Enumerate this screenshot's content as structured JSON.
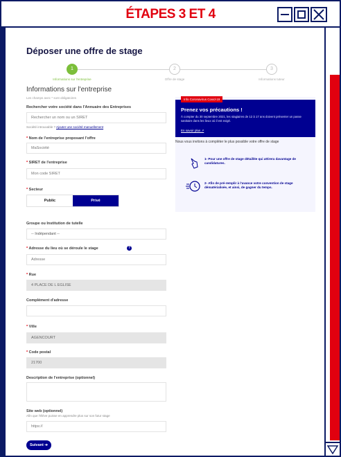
{
  "window": {
    "title": "ÉTAPES 3 ET 4"
  },
  "page": {
    "title": "Déposer une offre de stage"
  },
  "stepper": {
    "steps": [
      {
        "number": "1",
        "label": "Informations sur l'entreprise"
      },
      {
        "number": "2",
        "label": "Offre de stage"
      },
      {
        "number": "3",
        "label": "Informations tuteur"
      }
    ]
  },
  "section": {
    "title": "Informations sur l'entreprise",
    "required_note": "Les champs avec * sont obligatoires"
  },
  "form": {
    "search": {
      "label": "Rechercher votre société dans l'Annuaire des Entreprises",
      "placeholder": "Rechercher un nom ou un SIRET",
      "hint": "Société introuvable ?",
      "hint_link": "Ajouter une société manuellement"
    },
    "company_name": {
      "label": "Nom de l'entreprise proposant l'offre",
      "placeholder": "MaSociété"
    },
    "siret": {
      "label": "SIRET de l'entreprise",
      "placeholder": "Mon code SIRET"
    },
    "sector": {
      "label": "Secteur",
      "public": "Public",
      "prive": "Privé"
    },
    "group": {
      "label": "Groupe ou Institution de tutelle",
      "value": "-- Indépendant --"
    },
    "address": {
      "label": "Adresse du lieu où se déroule le stage",
      "placeholder": "Adresse"
    },
    "street": {
      "label": "Rue",
      "value": "4 PLACE DE L EGLISE"
    },
    "complement": {
      "label": "Complément d'adresse",
      "value": ""
    },
    "city": {
      "label": "Ville",
      "value": "AGENCOURT"
    },
    "postal": {
      "label": "Code postal",
      "value": "21700"
    },
    "description": {
      "label": "Description de l'entreprise (optionnel)",
      "value": ""
    },
    "website": {
      "label": "Site web (optionnel)",
      "hint": "Afin que l'élève puisse en apprendre plus sur son futur stage",
      "placeholder": "https://"
    },
    "next": "Suivant ➔"
  },
  "covid": {
    "tag": "Info Coronavirus Covid-19",
    "title": "Prenez vos précautions !",
    "text": "À compter du 30 septembre 2021, les stagiaires de 12 à 17 ans doivent présenter un passe sanitaire dans les lieux où il est exigé.",
    "more": "En savoir plus ↗"
  },
  "sidebar": {
    "invite": "Nous vous invitons à compléter le plus possible votre offre de stage",
    "tips": [
      {
        "icon": "pointer-hand-icon",
        "text": "1- Pour une offre de stage détaillée qui attirera davantage de candidatures."
      },
      {
        "icon": "fast-clock-icon",
        "text": "2- Afin de pré-remplir à l'avance votre convention de stage dématérialisée, et ainsi, de gagner du temps."
      }
    ]
  },
  "colors": {
    "primary": "#000091",
    "accent_red": "#e1000f",
    "step_active": "#7cbf3a",
    "frame": "#0b1a64"
  }
}
